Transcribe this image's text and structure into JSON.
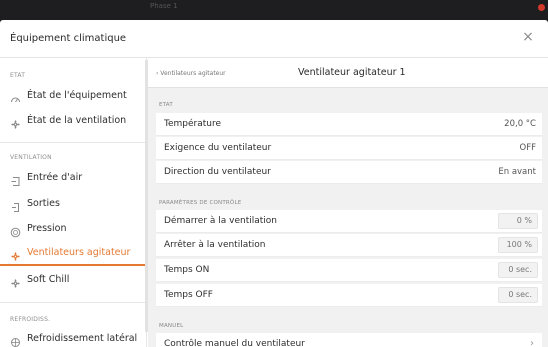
{
  "backdrop": {
    "title": "Phase 1"
  },
  "dialog": {
    "title": "Équipement climatique",
    "close_label": "×"
  },
  "sidebar": {
    "sections": [
      {
        "label": "ETAT"
      },
      {
        "label": "VENTILATION"
      },
      {
        "label": "REFROIDISS."
      }
    ],
    "items": [
      {
        "label": "État de l'équipement",
        "icon": "gauge-icon"
      },
      {
        "label": "État de la ventilation",
        "icon": "fan-icon"
      },
      {
        "label": "Entrée d'air",
        "icon": "inlet-icon"
      },
      {
        "label": "Sorties",
        "icon": "outlet-icon"
      },
      {
        "label": "Pression",
        "icon": "pressure-icon"
      },
      {
        "label": "Ventilateurs agitateur",
        "icon": "fan-icon",
        "active": true
      },
      {
        "label": "Soft Chill",
        "icon": "fan-icon"
      },
      {
        "label": "Refroidissement latéral",
        "icon": "cooling-icon"
      }
    ],
    "accent_color": "#e47a32"
  },
  "main": {
    "back_label": "‹  Ventilateurs agitateur",
    "title": "Ventilateur agitateur 1",
    "groups": [
      {
        "label": "ETAT",
        "rows": [
          {
            "label": "Température",
            "value": "20,0 °C"
          },
          {
            "label": "Exigence du ventilateur",
            "value": "OFF"
          },
          {
            "label": "Direction du ventilateur",
            "value": "En avant"
          }
        ]
      },
      {
        "label": "PARAMÈTRES DE CONTRÔLE",
        "rows": [
          {
            "label": "Démarrer à la ventilation",
            "value": "0 %"
          },
          {
            "label": "Arrêter à la ventilation",
            "value": "100 %"
          },
          {
            "label": "Temps ON",
            "value": "0 sec."
          },
          {
            "label": "Temps OFF",
            "value": "0 sec."
          }
        ]
      },
      {
        "label": "MANUEL",
        "rows": [
          {
            "label": "Contrôle manuel du ventilateur",
            "value": "›"
          }
        ]
      }
    ]
  }
}
